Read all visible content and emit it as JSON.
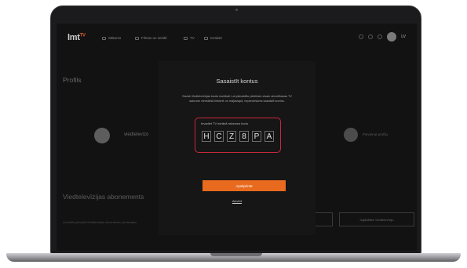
{
  "app": {
    "logo": "lmt",
    "logo_sup": "TV",
    "nav": [
      {
        "label": "Sākums",
        "icon": "home-icon"
      },
      {
        "label": "Filmas un seriāli",
        "icon": "film-icon"
      },
      {
        "label": "TV",
        "icon": "tv-icon"
      },
      {
        "label": "Ierakstī",
        "icon": "record-icon"
      }
    ],
    "header_icons": [
      "search-icon",
      "cast-icon",
      "settings-icon"
    ],
    "user_initials": "LV"
  },
  "background": {
    "profils_title": "Profils",
    "left_profile_name": "viedtelevizo",
    "right_profile_name": "Pievienot profilu",
    "subscription_title": "Viedtelevīzijas abonements",
    "subscription_text": "Lai varētu pārvaldīt Viedtelevīzijas abonementu, pievienojies.",
    "buttons": [
      "Pievienot Viedtelevīziju",
      "Iegādāties Viedtelevīziju"
    ]
  },
  "modal": {
    "title": "Sasaistīt kontus",
    "description": "Savaš Viedtelevīzijas kontu kontikat! Lai pārvaldītu pieklūstu visam abonēšanas TV saturam vienkāršā lietotnē un mājaslapā, nepieciešams sasaistīt kontus.",
    "code_label": "Ievadiet TV ekrānā redzamo kodu",
    "code": [
      "H",
      "C",
      "Z",
      "8",
      "P",
      "A"
    ],
    "confirm_label": "Apstiprināt",
    "close_label": "Aizvērt"
  },
  "colors": {
    "accent": "#e86a1e",
    "highlight": "#c8283c",
    "screen_bg": "#121212"
  }
}
